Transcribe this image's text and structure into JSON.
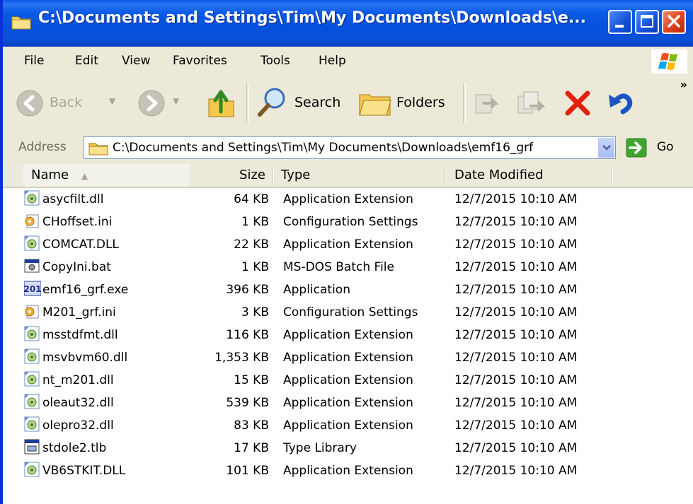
{
  "window": {
    "title": "C:\\Documents and Settings\\Tim\\My Documents\\Downloads\\e..."
  },
  "menu": [
    "File",
    "Edit",
    "View",
    "Favorites",
    "Tools",
    "Help"
  ],
  "toolbar": {
    "back_label": "Back",
    "search_label": "Search",
    "folders_label": "Folders",
    "more_label": "»"
  },
  "address": {
    "label": "Address",
    "value": "C:\\Documents and Settings\\Tim\\My Documents\\Downloads\\emf16_grf",
    "go_label": "Go"
  },
  "columns": {
    "name": "Name",
    "size": "Size",
    "type": "Type",
    "date": "Date Modified"
  },
  "files": [
    {
      "name": "asycfilt.dll",
      "size": "64 KB",
      "type": "Application Extension",
      "date": "12/7/2015 10:10 AM",
      "icon": "dll-icon"
    },
    {
      "name": "CHoffset.ini",
      "size": "1 KB",
      "type": "Configuration Settings",
      "date": "12/7/2015 10:10 AM",
      "icon": "ini-icon"
    },
    {
      "name": "COMCAT.DLL",
      "size": "22 KB",
      "type": "Application Extension",
      "date": "12/7/2015 10:10 AM",
      "icon": "dll-icon"
    },
    {
      "name": "CopyIni.bat",
      "size": "1 KB",
      "type": "MS-DOS Batch File",
      "date": "12/7/2015 10:10 AM",
      "icon": "bat-icon"
    },
    {
      "name": "emf16_grf.exe",
      "size": "396 KB",
      "type": "Application",
      "date": "12/7/2015 10:10 AM",
      "icon": "exe-icon",
      "icon_text": "201"
    },
    {
      "name": "M201_grf.ini",
      "size": "3 KB",
      "type": "Configuration Settings",
      "date": "12/7/2015 10:10 AM",
      "icon": "ini-icon"
    },
    {
      "name": "msstdfmt.dll",
      "size": "116 KB",
      "type": "Application Extension",
      "date": "12/7/2015 10:10 AM",
      "icon": "dll-icon"
    },
    {
      "name": "msvbvm60.dll",
      "size": "1,353 KB",
      "type": "Application Extension",
      "date": "12/7/2015 10:10 AM",
      "icon": "dll-icon"
    },
    {
      "name": "nt_m201.dll",
      "size": "15 KB",
      "type": "Application Extension",
      "date": "12/7/2015 10:10 AM",
      "icon": "dll-icon"
    },
    {
      "name": "oleaut32.dll",
      "size": "539 KB",
      "type": "Application Extension",
      "date": "12/7/2015 10:10 AM",
      "icon": "dll-icon"
    },
    {
      "name": "olepro32.dll",
      "size": "83 KB",
      "type": "Application Extension",
      "date": "12/7/2015 10:10 AM",
      "icon": "dll-icon"
    },
    {
      "name": "stdole2.tlb",
      "size": "17 KB",
      "type": "Type Library",
      "date": "12/7/2015 10:10 AM",
      "icon": "tlb-icon"
    },
    {
      "name": "VB6STKIT.DLL",
      "size": "101 KB",
      "type": "Application Extension",
      "date": "12/7/2015 10:10 AM",
      "icon": "dll-icon"
    }
  ],
  "colors": {
    "titlebar": "#0a56e8",
    "chrome": "#ece9d8",
    "close": "#e0401a"
  }
}
